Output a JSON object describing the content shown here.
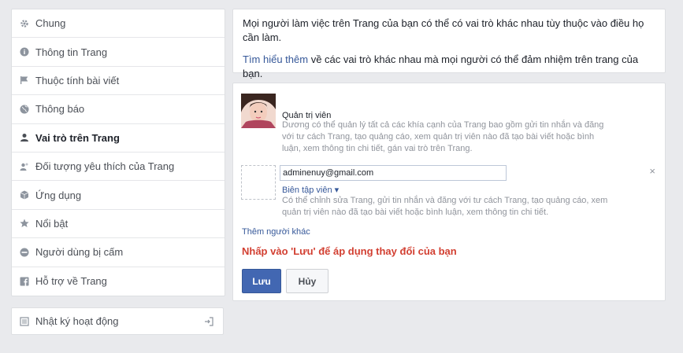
{
  "sidebar": {
    "items": [
      {
        "label": "Chung",
        "icon": "gear-icon"
      },
      {
        "label": "Thông tin Trang",
        "icon": "info-icon"
      },
      {
        "label": "Thuộc tính bài viết",
        "icon": "flag-icon"
      },
      {
        "label": "Thông báo",
        "icon": "globe-icon"
      },
      {
        "label": "Vai trò trên Trang",
        "icon": "person-icon",
        "active": true
      },
      {
        "label": "Đối tượng yêu thích của Trang",
        "icon": "people-icon"
      },
      {
        "label": "Ứng dụng",
        "icon": "cube-icon"
      },
      {
        "label": "Nổi bật",
        "icon": "star-icon"
      },
      {
        "label": "Người dùng bị cấm",
        "icon": "ban-icon"
      },
      {
        "label": "Hỗ trợ về Trang",
        "icon": "facebook-icon"
      }
    ]
  },
  "activity_log": {
    "label": "Nhật ký hoạt động",
    "icon": "exit-icon"
  },
  "info": {
    "paragraph1": "Mọi người làm việc trên Trang của bạn có thể có vai trò khác nhau tùy thuộc vào điều họ cần làm.",
    "learn_more": "Tìm hiểu thêm",
    "paragraph2_rest": " về các vai trò khác nhau mà mọi người có thể đảm nhiệm trên trang của bạn."
  },
  "admin": {
    "role": "Quản trị viên",
    "description": "Dương có thể quản lý tất cả các khía cạnh của Trang bao gồm gửi tin nhắn và đăng với tư cách Trang, tạo quảng cáo, xem quản trị viên nào đã tạo bài viết hoặc bình luận, xem thông tin chi tiết, gán vai trò trên Trang."
  },
  "new_role": {
    "email": "adminenuy@gmail.com",
    "role_select": "Biên tập viên ▾",
    "description": "Có thể chỉnh sửa Trang, gửi tin nhắn và đăng với tư cách Trang, tạo quảng cáo, xem quản trị viên nào đã tạo bài viết hoặc bình luận, xem thông tin chi tiết.",
    "remove": "×"
  },
  "add_other": "Thêm người khác",
  "warning": "Nhấp vào 'Lưu' để áp dụng thay đổi của bạn",
  "buttons": {
    "save": "Lưu",
    "cancel": "Hủy"
  }
}
